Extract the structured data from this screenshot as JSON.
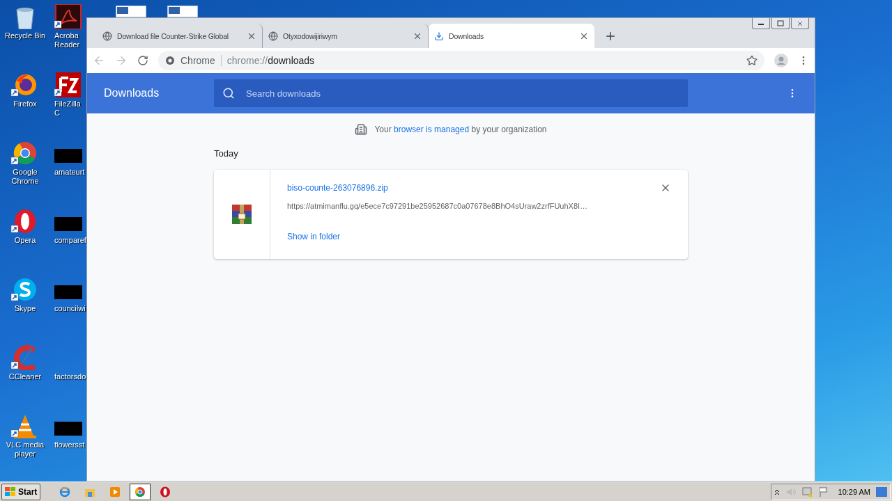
{
  "desktop": {
    "icons": [
      {
        "label": "Recycle Bin",
        "kind": "recycle",
        "shortcut": false
      },
      {
        "label": "Firefox",
        "kind": "firefox",
        "shortcut": true
      },
      {
        "label": "Google Chrome",
        "kind": "chrome",
        "shortcut": true
      },
      {
        "label": "Opera",
        "kind": "opera",
        "shortcut": true
      },
      {
        "label": "Skype",
        "kind": "skype",
        "shortcut": true
      },
      {
        "label": "CCleaner",
        "kind": "ccleaner",
        "shortcut": true
      },
      {
        "label": "VLC media player",
        "kind": "vlc",
        "shortcut": true
      }
    ],
    "icons_2": [
      {
        "label": "Acroba Reader",
        "kind": "acrobat",
        "shortcut": true
      },
      {
        "label": "FileZilla C",
        "kind": "filezilla",
        "shortcut": true
      },
      {
        "label": "amateurt",
        "kind": "blacked",
        "shortcut": false
      },
      {
        "label": "comparef",
        "kind": "blacked",
        "shortcut": false
      },
      {
        "label": "councilwi",
        "kind": "blacked",
        "shortcut": false
      },
      {
        "label": "factorsdo",
        "kind": "none"
      },
      {
        "label": "flowersst",
        "kind": "blacked",
        "shortcut": false
      }
    ]
  },
  "browser": {
    "tabs": [
      {
        "title": "Download file Counter-Strike Global",
        "kind": "globe",
        "selected": false
      },
      {
        "title": "Otyxodowijiriwym",
        "kind": "globe",
        "selected": false
      },
      {
        "title": "Downloads",
        "kind": "download",
        "selected": true
      }
    ],
    "omnibox": {
      "chip": "Chrome",
      "scheme": "chrome://",
      "path": "downloads"
    }
  },
  "downloads_page": {
    "title": "Downloads",
    "search": {
      "placeholder": "Search downloads"
    },
    "notice": {
      "before": "Your",
      "link": "browser is managed",
      "after": "by your organization"
    },
    "section": "Today",
    "items": [
      {
        "filename": "biso-counte-263076896.zip",
        "url": "https://atmimanflu.gq/e5ece7c97291be25952687c0a07678e8BhO4sUraw2zrfFUuhX8I…",
        "action": "Show in folder"
      }
    ]
  },
  "taskbar": {
    "start": "Start",
    "apps": [
      {
        "kind": "ie",
        "selected": false
      },
      {
        "kind": "explorer",
        "selected": false
      },
      {
        "kind": "media",
        "selected": false
      },
      {
        "kind": "chrome",
        "selected": true
      },
      {
        "kind": "opera",
        "selected": false
      }
    ],
    "clock": "10:29 AM"
  }
}
